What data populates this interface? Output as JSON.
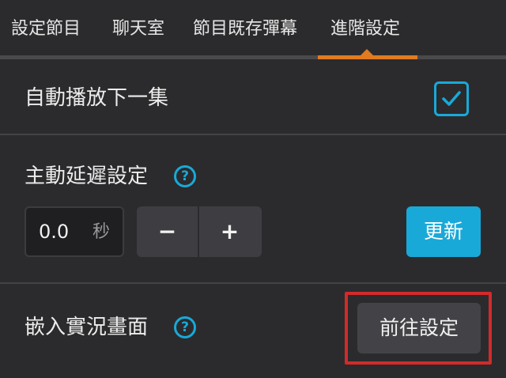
{
  "tabs": [
    {
      "label": "設定節目"
    },
    {
      "label": "聊天室"
    },
    {
      "label": "節目既存彈幕"
    },
    {
      "label": "進階設定"
    }
  ],
  "active_tab": "進階設定",
  "autoplay": {
    "label": "自動播放下一集",
    "checked": true
  },
  "delay": {
    "label": "主動延遲設定",
    "help_glyph": "?",
    "value": "0.0",
    "unit": "秒",
    "minus_label": "−",
    "plus_label": "+",
    "update_label": "更新"
  },
  "embed": {
    "label": "嵌入實況畫面",
    "help_glyph": "?",
    "goto_label": "前往設定"
  },
  "colors": {
    "background": "#2b2b2d",
    "accent_blue": "#19a9d8",
    "tab_indicator": "#e07b1f",
    "highlight_red": "#d22a2a"
  }
}
